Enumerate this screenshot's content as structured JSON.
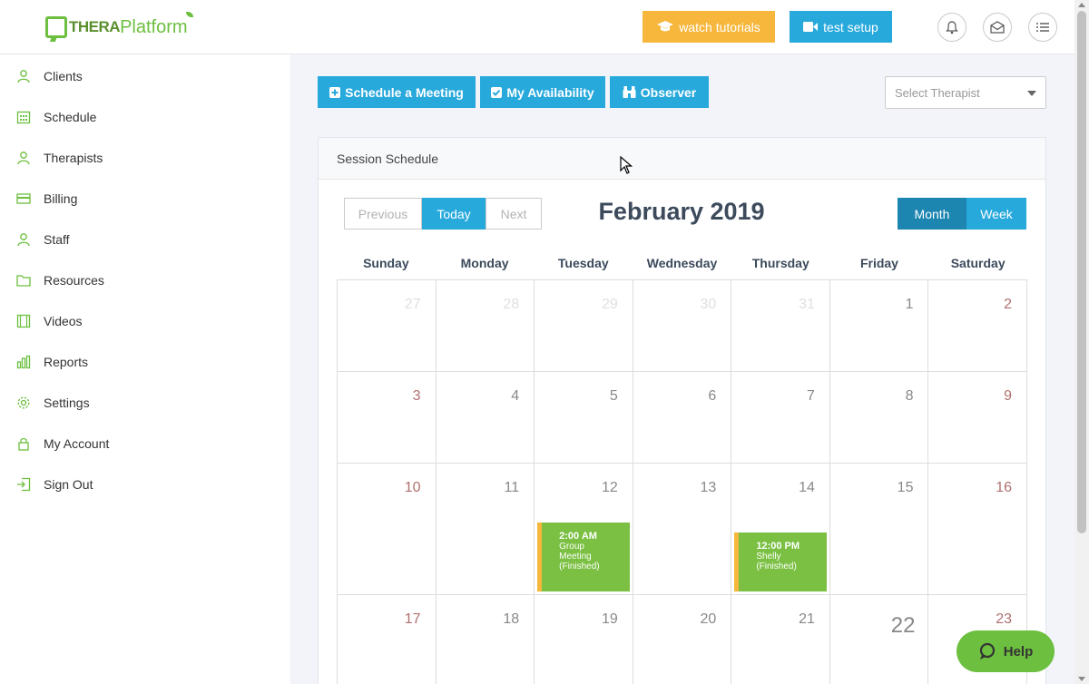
{
  "header": {
    "logo": {
      "part1": "THERA",
      "part2": "Platform"
    },
    "watch_tutorials": "watch tutorials",
    "test_setup": "test setup"
  },
  "sidebar": {
    "items": [
      {
        "label": "Clients",
        "icon": "clients-icon"
      },
      {
        "label": "Schedule",
        "icon": "calendar-icon"
      },
      {
        "label": "Therapists",
        "icon": "therapists-icon"
      },
      {
        "label": "Billing",
        "icon": "card-icon"
      },
      {
        "label": "Staff",
        "icon": "staff-icon"
      },
      {
        "label": "Resources",
        "icon": "folder-icon"
      },
      {
        "label": "Videos",
        "icon": "film-icon"
      },
      {
        "label": "Reports",
        "icon": "bar-chart-icon"
      },
      {
        "label": "Settings",
        "icon": "gear-icon"
      },
      {
        "label": "My Account",
        "icon": "lock-icon"
      },
      {
        "label": "Sign Out",
        "icon": "sign-out-icon"
      }
    ]
  },
  "toolbar": {
    "schedule_meeting": "Schedule a Meeting",
    "my_availability": "My Availability",
    "observer": "Observer",
    "select_therapist_placeholder": "Select Therapist"
  },
  "card": {
    "title": "Session Schedule"
  },
  "calendar": {
    "previous": "Previous",
    "today": "Today",
    "next": "Next",
    "month_title": "February 2019",
    "view_month": "Month",
    "view_week": "Week",
    "days_of_week": [
      "Sunday",
      "Monday",
      "Tuesday",
      "Wednesday",
      "Thursday",
      "Friday",
      "Saturday"
    ],
    "weeks": [
      [
        "27",
        "28",
        "29",
        "30",
        "31",
        "1",
        "2"
      ],
      [
        "3",
        "4",
        "5",
        "6",
        "7",
        "8",
        "9"
      ],
      [
        "10",
        "11",
        "12",
        "13",
        "14",
        "15",
        "16"
      ],
      [
        "17",
        "18",
        "19",
        "20",
        "21",
        "22",
        "23"
      ]
    ],
    "events": [
      {
        "time": "2:00 AM",
        "title": "Group Meeting",
        "status": "(Finished)"
      },
      {
        "time": "12:00 PM",
        "title": "Shelly",
        "status": "(Finished)"
      }
    ]
  },
  "help": {
    "label": "Help"
  },
  "colors": {
    "primary": "#27a9dc",
    "primary_dark": "#1c85b0",
    "accent": "#f6b73c",
    "green": "#7bc043"
  }
}
